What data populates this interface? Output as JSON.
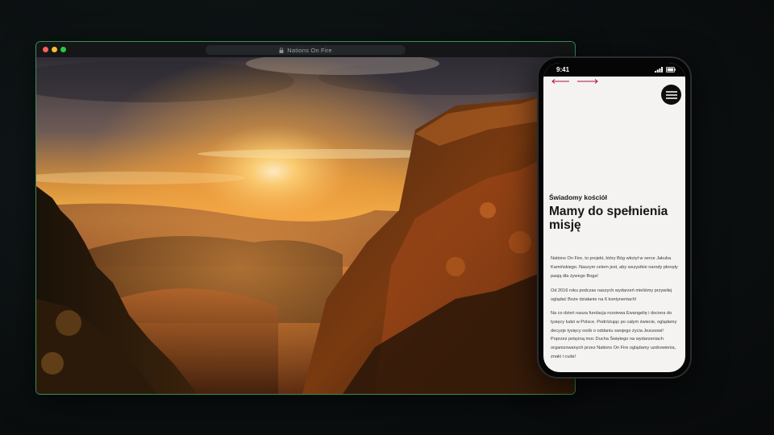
{
  "browser": {
    "url_text": "Nations On Fire",
    "hero_image": "mountain-sunset-forest"
  },
  "phone": {
    "time": "9:41",
    "kicker": "Świadomy kościół",
    "heading": "Mamy do spełnienia misję",
    "paragraphs": [
      "Nations On Fire, to projekt, który Bóg włożył w serce Jakuba Kamińskiego. Naszym celem jest, aby wszystkie narody płonęły pasją dla żywego Boga!",
      "Od 2016 roku podczas naszych wydarzeń mieliśmy przywilej oglądać Boże działanie na 6 kontynentach!",
      "Na co dzień nasza fundacja rozsiewa Ewangelię i dociera do tysięcy ludzi w Polsce. Podróżując po całym świecie, oglądamy decyzje tysięcy osób o oddaniu swojego życia Jezusowi! Poprzez potężną moc Ducha Świętego na wydarzeniach organizowanych przez Nations On Fire oglądamy uzdrowienia, znaki i cuda!"
    ]
  },
  "colors": {
    "accent_border": "#3a8f57",
    "nav_arrow": "#b3123a",
    "background": "#0b0f10"
  }
}
